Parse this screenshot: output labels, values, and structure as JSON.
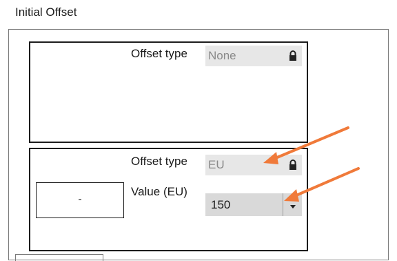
{
  "section": {
    "title": "Initial Offset"
  },
  "panel1": {
    "offset_type_label": "Offset type",
    "offset_type_value": "None"
  },
  "panel2": {
    "offset_type_label": "Offset type",
    "offset_type_value": "EU",
    "value_label": "Value (EU)",
    "value": "150",
    "small_box_text": "-"
  },
  "colors": {
    "annotation_arrow": "#f07a3a",
    "readonly_field_bg": "#e7e7e7",
    "combo_bg": "#d9d9d9"
  },
  "icons": [
    "lock-icon",
    "chevron-down-icon",
    "annotation-arrow"
  ]
}
